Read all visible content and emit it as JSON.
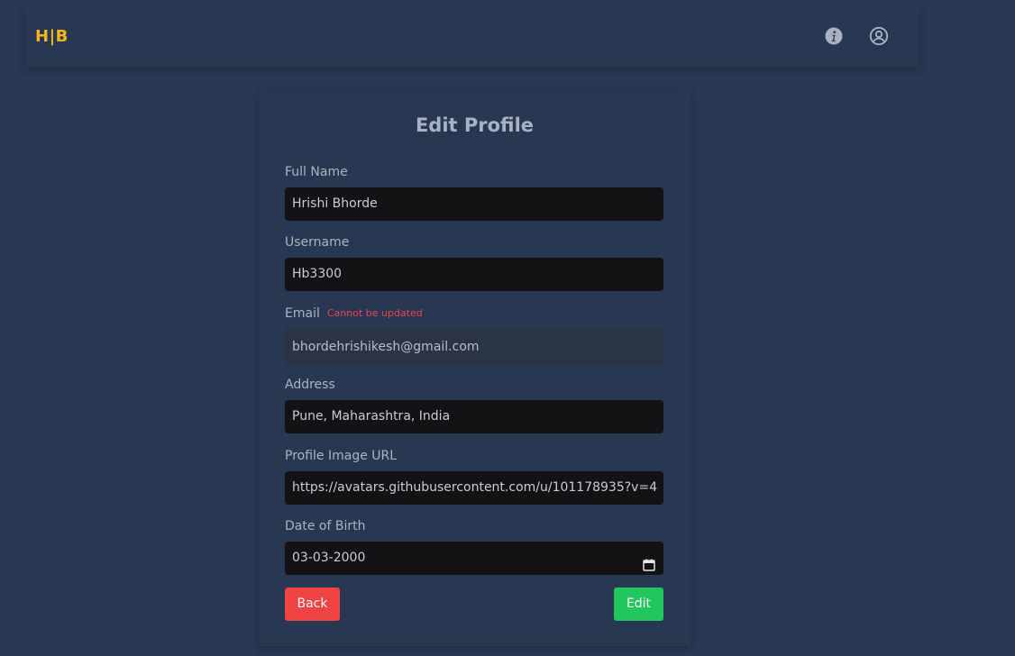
{
  "nav": {
    "logo": "H|B",
    "info_icon": "info-icon",
    "user_icon": "user-circle-icon"
  },
  "form": {
    "title": "Edit Profile",
    "full_name": {
      "label": "Full Name",
      "value": "Hrishi Bhorde"
    },
    "username": {
      "label": "Username",
      "value": "Hb3300"
    },
    "email": {
      "label": "Email",
      "note": "Cannot be updated",
      "value": "bhordehrishikesh@gmail.com"
    },
    "address": {
      "label": "Address",
      "value": "Pune, Maharashtra, India"
    },
    "profile_image": {
      "label": "Profile Image URL",
      "value": "https://avatars.githubusercontent.com/u/101178935?v=4"
    },
    "dob": {
      "label": "Date of Birth",
      "value": "03-03-2000"
    },
    "back_label": "Back",
    "edit_label": "Edit"
  },
  "colors": {
    "background": "#283852",
    "logo": "#f3b51b",
    "back_button": "#ef4444",
    "edit_button": "#22c55e",
    "note": "#f04050"
  }
}
